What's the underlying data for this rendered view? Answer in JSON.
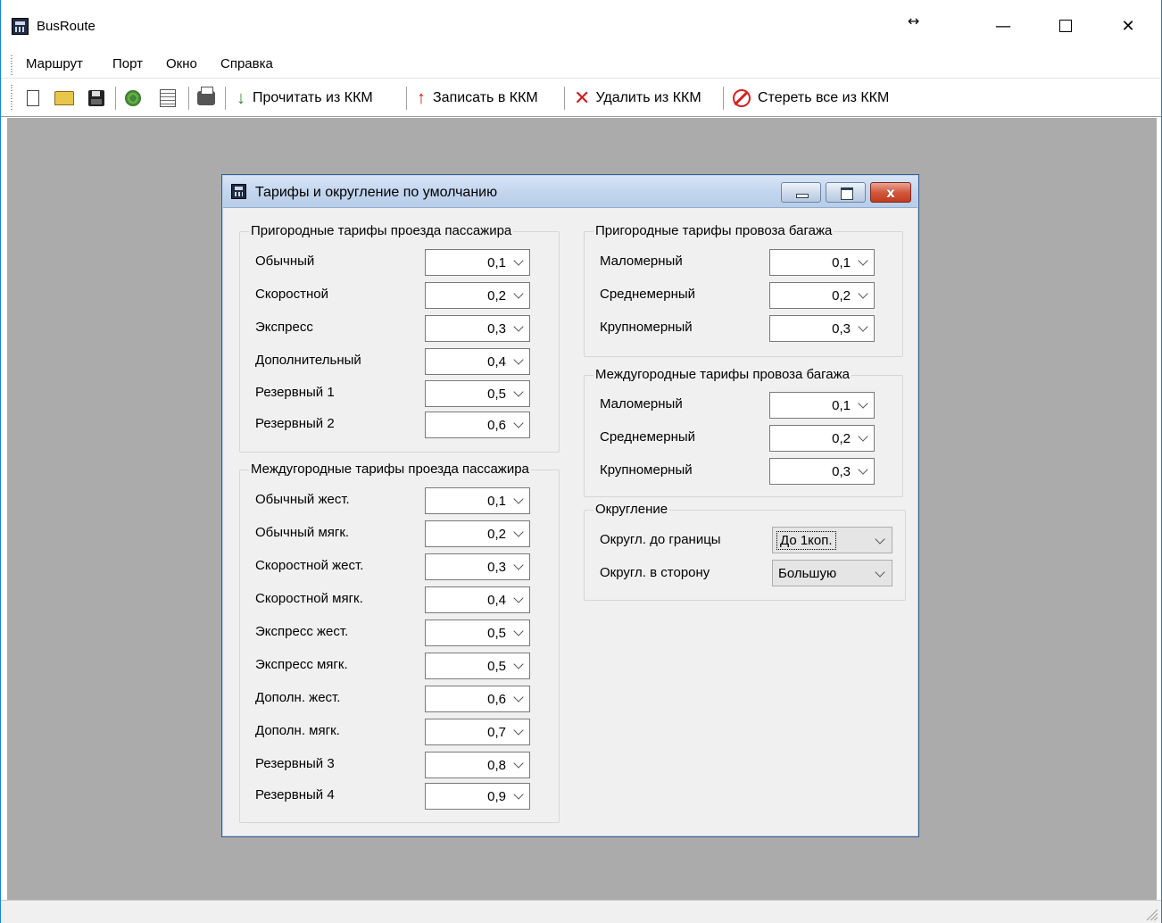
{
  "app": {
    "title": "BusRoute",
    "resize_glyph": "↔",
    "window_controls": {
      "minimize": "—",
      "close": "✕"
    }
  },
  "menu": [
    "Маршрут",
    "Порт",
    "Окно",
    "Справка"
  ],
  "toolbar": {
    "icons": [
      "new-file-icon",
      "open-folder-icon",
      "save-icon",
      "settings-icon",
      "properties-icon",
      "print-icon"
    ],
    "read_label": "Прочитать из ККМ",
    "write_label": "Записать в ККМ",
    "delete_label": "Удалить из ККМ",
    "erase_label": "Стереть все из ККМ",
    "colors": {
      "read_arrow": "#2e8b2e",
      "write_arrow": "#cc2020",
      "delete_cross": "#cc2020",
      "erase_icon": "#d82020"
    }
  },
  "dialog": {
    "title": "Тарифы и округление по умолчанию",
    "close_glyph": "x",
    "suburban_passenger": {
      "title": "Пригородные тарифы проезда пассажира",
      "rows": [
        {
          "label": "Обычный",
          "value": "0,1"
        },
        {
          "label": "Скоростной",
          "value": "0,2"
        },
        {
          "label": "Экспресс",
          "value": "0,3"
        },
        {
          "label": "Дополнительный",
          "value": "0,4"
        },
        {
          "label": "Резервный 1",
          "value": "0,5"
        },
        {
          "label": "Резервный 2",
          "value": "0,6"
        }
      ]
    },
    "intercity_passenger": {
      "title": "Междугородные тарифы проезда пассажира",
      "rows": [
        {
          "label": "Обычный жест.",
          "value": "0,1"
        },
        {
          "label": "Обычный мягк.",
          "value": "0,2"
        },
        {
          "label": "Скоростной жест.",
          "value": "0,3"
        },
        {
          "label": "Скоростной мягк.",
          "value": "0,4"
        },
        {
          "label": "Экспресс жест.",
          "value": "0,5"
        },
        {
          "label": "Экспресс мягк.",
          "value": "0,5"
        },
        {
          "label": "Дополн. жест.",
          "value": "0,6"
        },
        {
          "label": "Дополн. мягк.",
          "value": "0,7"
        },
        {
          "label": "Резервный 3",
          "value": "0,8"
        },
        {
          "label": "Резервный 4",
          "value": "0,9"
        }
      ]
    },
    "suburban_baggage": {
      "title": "Пригородные тарифы провоза багажа",
      "rows": [
        {
          "label": "Маломерный",
          "value": "0,1"
        },
        {
          "label": "Среднемерный",
          "value": "0,2"
        },
        {
          "label": "Крупномерный",
          "value": "0,3"
        }
      ]
    },
    "intercity_baggage": {
      "title": "Междугородные тарифы провоза багажа",
      "rows": [
        {
          "label": "Маломерный",
          "value": "0,1"
        },
        {
          "label": "Среднемерный",
          "value": "0,2"
        },
        {
          "label": "Крупномерный",
          "value": "0,3"
        }
      ]
    },
    "rounding": {
      "title": "Округление",
      "boundary_label": "Округл. до границы",
      "boundary_value": "До 1коп.",
      "direction_label": "Округл. в сторону",
      "direction_value": "Большую"
    }
  }
}
